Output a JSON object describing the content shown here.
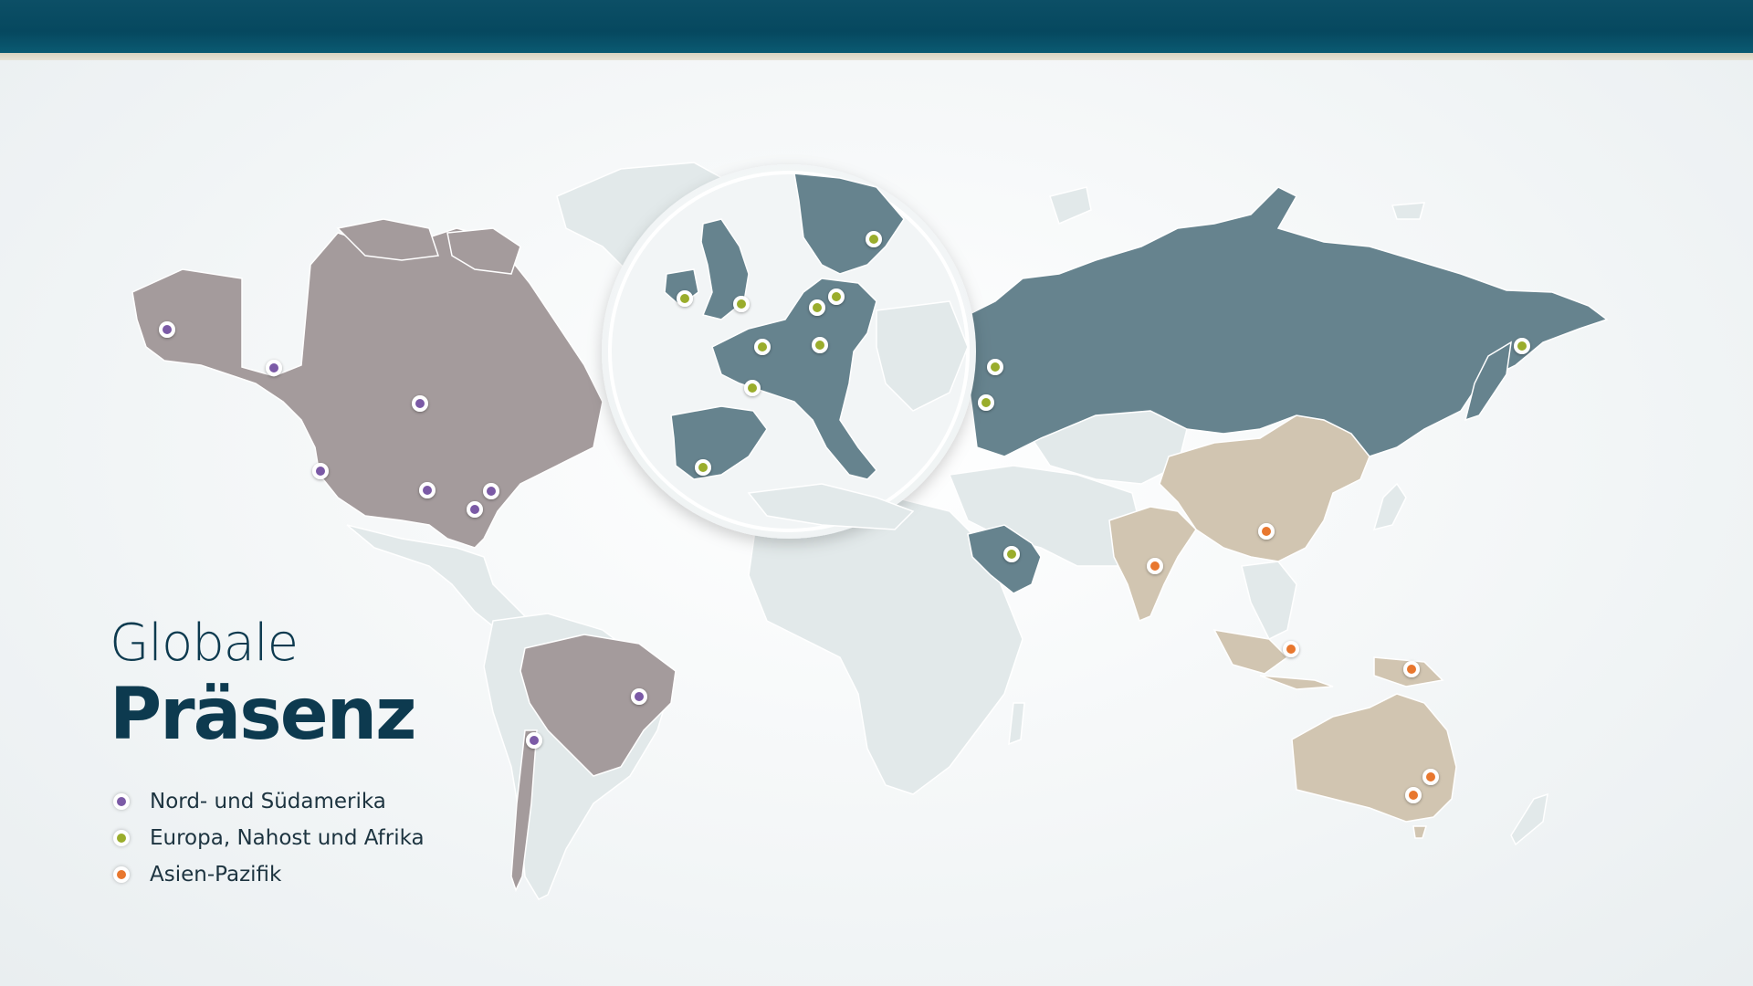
{
  "title": {
    "line1": "Globale",
    "line2": "Präsenz"
  },
  "legend": [
    {
      "label": "Nord- und Südamerika",
      "color": "#7b5aa6"
    },
    {
      "label": "Europa, Nahost und Afrika",
      "color": "#9aad2c"
    },
    {
      "label": "Asien-Pazifik",
      "color": "#e8772e"
    }
  ],
  "colors": {
    "topbar": "#06485f",
    "americas_land": "#a49b9c",
    "emea_land": "#66838e",
    "apac_land": "#d1c5b1",
    "other_land": "#e2e9ea",
    "title": "#0d3a4f"
  }
}
